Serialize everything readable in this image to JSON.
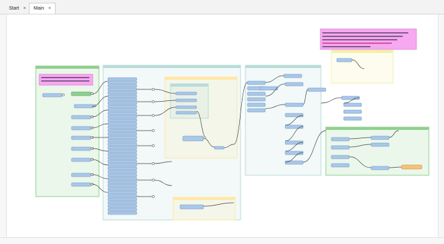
{
  "tabs": [
    {
      "label": "Start",
      "close": "×",
      "active": false
    },
    {
      "label": "Main",
      "close": "×",
      "active": true
    }
  ],
  "colors": {
    "bookmark_green": "#8fd08f",
    "bookmark_blue": "#b8dcd8",
    "bookmark_orange": "#ffe7a6",
    "bookmark_yellow": "#f3f0a8",
    "transformer": "#a9c8ea",
    "annotation_pink": "#f6a8f0",
    "connector": "#444444"
  },
  "icons": [
    "close-icon",
    "workspace-canvas",
    "bookmark-frame",
    "transformer-node",
    "annotation-note",
    "connection-link",
    "output-port",
    "input-port"
  ]
}
